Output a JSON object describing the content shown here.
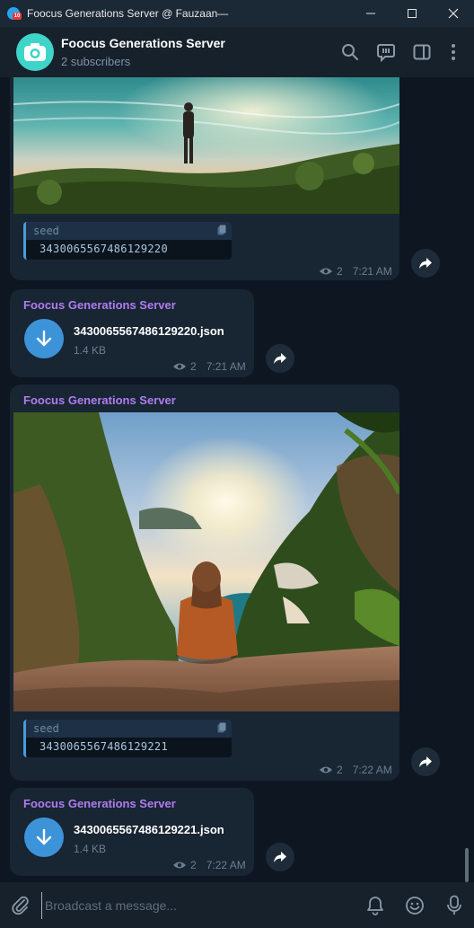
{
  "window": {
    "title": "Foocus Generations Server @ Fauzaan—"
  },
  "channel": {
    "name": "Foocus Generations Server",
    "subtitle": "2 subscribers"
  },
  "messages": [
    {
      "type": "photo",
      "code_lang": "seed",
      "code_value": "3430065567486129220",
      "views": "2",
      "time": "7:21 AM"
    },
    {
      "type": "file",
      "sender": "Foocus Generations Server",
      "file_name": "3430065567486129220.json",
      "file_size": "1.4 KB",
      "views": "2",
      "time": "7:21 AM"
    },
    {
      "type": "photo",
      "sender": "Foocus Generations Server",
      "code_lang": "seed",
      "code_value": "3430065567486129221",
      "views": "2",
      "time": "7:22 AM"
    },
    {
      "type": "file",
      "sender": "Foocus Generations Server",
      "file_name": "3430065567486129221.json",
      "file_size": "1.4 KB",
      "views": "2",
      "time": "7:22 AM"
    }
  ],
  "composer": {
    "placeholder": "Broadcast a message..."
  },
  "colors": {
    "background": "#0e1621",
    "bubble": "#182533",
    "sender": "#b07cf0",
    "accent": "#3d93d8"
  }
}
